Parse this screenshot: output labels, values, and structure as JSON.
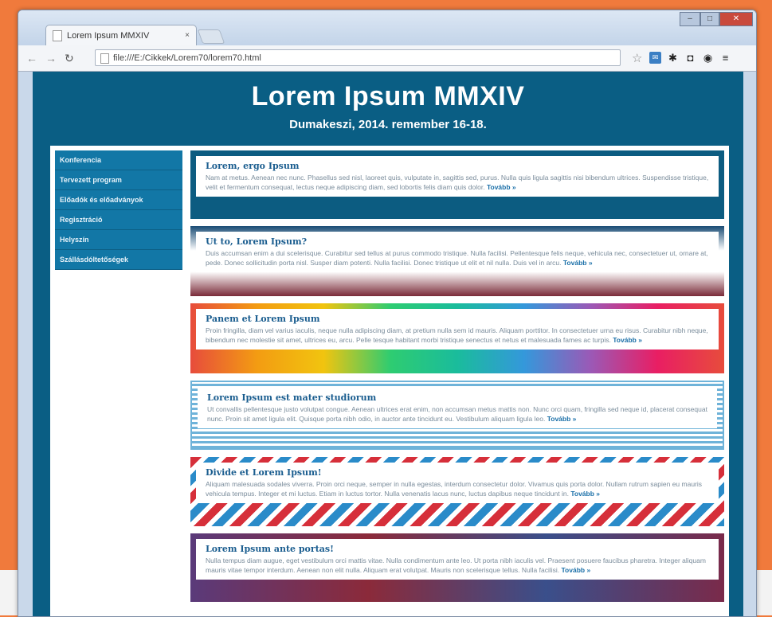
{
  "browser": {
    "tab_title": "Lorem Ipsum MMXIV",
    "tab_close": "×",
    "url": "file:///E:/Cikkek/Lorem70/lorem70.html",
    "controls": {
      "minimize": "–",
      "maximize": "□",
      "close": "✕"
    }
  },
  "page": {
    "title": "Lorem Ipsum MMXIV",
    "subtitle": "Dumakeszi, 2014. remember 16-18."
  },
  "sidebar": {
    "items": [
      {
        "label": "Konferencia"
      },
      {
        "label": "Tervezett program"
      },
      {
        "label": "Előadók és előadványok"
      },
      {
        "label": "Regisztráció"
      },
      {
        "label": "Helyszín"
      },
      {
        "label": "Szállásdóltetőségek"
      }
    ]
  },
  "articles": [
    {
      "title": "Lorem, ergo Ipsum",
      "text": "Nam at metus. Aenean nec nunc. Phasellus sed nisl, laoreet quis, vulputate in, sagittis sed, purus. Nulla quis ligula sagittis nisi bibendum ultrices. Suspendisse tristique, velit et fermentum consequat, lectus neque adipiscing diam, sed lobortis felis diam quis dolor.",
      "more": "Tovább »"
    },
    {
      "title": "Ut to, Lorem Ipsum?",
      "text": "Duis accumsan enim a dui scelerisque. Curabitur sed tellus at purus commodo tristique. Nulla facilisi. Pellentesque felis neque, vehicula nec, consectetuer ut, ornare at, pede. Donec sollicitudin porta nisl. Susper diam potenti. Nulla facilisi. Donec tristique ut elit et nil nulla. Duis vel in arcu.",
      "more": "Tovább »"
    },
    {
      "title": "Panem et Lorem Ipsum",
      "text": "Proin fringilla, diam vel varius iaculis, neque nulla adipiscing diam, at pretium nulla sem id mauris. Aliquam porttitor. In consectetuer urna eu risus. Curabitur nibh neque, bibendum nec molestie sit amet, ultrices eu, arcu. Pelle tesque habitant morbi tristique senectus et netus et malesuada fames ac turpis.",
      "more": "Tovább »"
    },
    {
      "title": "Lorem Ipsum est mater studiorum",
      "text": "Ut convallis pellentesque justo volutpat congue. Aenean ultrices erat enim, non accumsan metus mattis non. Nunc orci quam, fringilla sed neque id, placerat consequat nunc. Proin sit amet ligula elit. Quisque porta nibh odio, in auctor ante tincidunt eu. Vestibulum aliquam ligula leo.",
      "more": "Tovább »"
    },
    {
      "title": "Divide et Lorem Ipsum!",
      "text": "Aliquam malesuada sodales viverra. Proin orci neque, semper in nulla egestas, interdum consectetur dolor. Vivamus quis porta dolor. Nullam rutrum sapien eu mauris vehicula tempus. Integer et mi luctus. Etiam in luctus tortor. Nulla venenatis lacus nunc, luctus dapibus neque tincidunt in.",
      "more": "Tovább »"
    },
    {
      "title": "Lorem Ipsum ante portas!",
      "text": "Nulla tempus diam augue, eget vestibulum orci mattis vitae. Nulla condimentum ante leo. Ut porta nibh iaculis vel. Praesent posuere faucibus pharetra. Integer aliquam mauris vitae tempor interdum. Aenean non elit nulla. Aliquam erat volutpat. Mauris non scelerisque tellus. Nulla facilisi.",
      "more": "Tovább »"
    }
  ]
}
